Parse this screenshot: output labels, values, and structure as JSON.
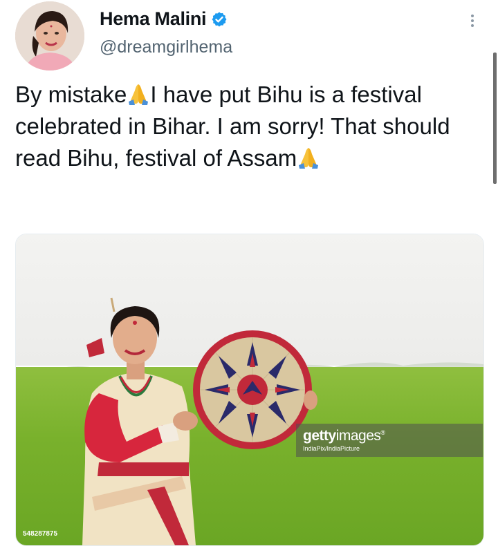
{
  "author": {
    "name": "Hema Malini",
    "handle": "@dreamgirlhema",
    "verified": true
  },
  "tweet": {
    "text_segments": [
      {
        "type": "text",
        "value": "By mistake"
      },
      {
        "type": "emoji",
        "value": "folded-hands-emoji"
      },
      {
        "type": "text",
        "value": "I have put Bihu is a festival celebrated in Bihar. I am sorry! That should read Bihu, festival of Assam"
      },
      {
        "type": "emoji",
        "value": "folded-hands-emoji"
      }
    ],
    "part1": "By mistake",
    "part2": "I have put Bihu is a festival celebrated in Bihar. I am sorry! That should read Bihu, festival of Assam"
  },
  "media": {
    "watermark_brand_bold": "getty",
    "watermark_brand_light": "images",
    "watermark_mark": "®",
    "watermark_credit": "IndiaPix/IndiaPicture",
    "image_id": "548287875"
  },
  "colors": {
    "verified_badge": "#1d9bf0",
    "text_primary": "#0f1419",
    "text_secondary": "#536471",
    "field_green": "#79b12c",
    "dancer_red": "#d7263d"
  },
  "icons": {
    "verified": "verified-badge-icon",
    "more": "more-options-icon",
    "emoji": "folded-hands-emoji"
  }
}
